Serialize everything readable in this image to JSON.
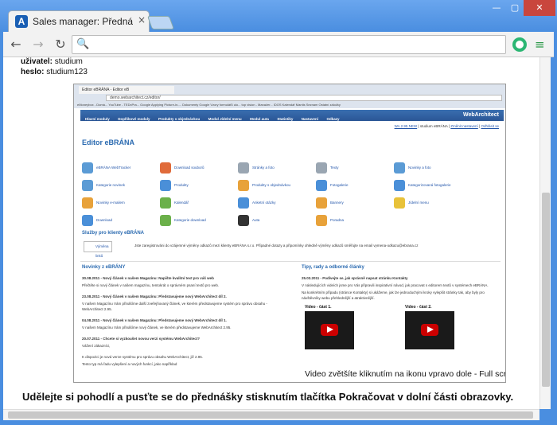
{
  "browser": {
    "tab_title": "Sales manager: Přednáška",
    "tab_close": "×",
    "min_glyph": "—",
    "max_glyph": "▢",
    "close_glyph": "✕",
    "back_glyph": "←",
    "forward_glyph": "→",
    "reload_glyph": "↻",
    "search_glyph": "🔍",
    "menu_glyph": "≡",
    "address_value": ""
  },
  "page": {
    "user_label": "uživatel:",
    "user_value": " studium",
    "pass_label": "heslo:",
    "pass_value": " studium123",
    "bottom_message": "Udělejte si pohodlí a pusťte se do přednášky stisknutím tlačítka Pokračovat v dolní části obrazovky.",
    "video_caption": "Video zvětšíte kliknutím na ikonu vpravo dole - Full screen"
  },
  "screenshot": {
    "tab": "Editor eBRÁNA - Editor eB",
    "url": "demo.webarchitect.cz/editor/",
    "bookmarks": "eMoneybox - Domá...  YouTube - TEDxPra...  Google  Applying Picture-in-...  Dokumenty Google  Vzory formulářů ulo...  top vision - Manažer...  IDOS  Kalendář  Mantis  Seznam  Ostatní záložky",
    "nav": [
      "Hlavní moduly",
      "Doplňkové moduly",
      "Produkty s objednávkou",
      "Modul Jídelní menu",
      "Modul auta",
      "Statistiky",
      "Nastavení",
      "Odkazy"
    ],
    "logo": "WebArchitect",
    "topbar_version": "WA 2.95 NEW",
    "topbar_user": " | studium eBRÁNA | ",
    "topbar_settings": "Změnit nastavení",
    "topbar_sep": " | ",
    "topbar_logout": "Odhlásit se",
    "editor_title": "Editor eBRÁNA",
    "modules": [
      {
        "label": "eBRÁNA WebTracker",
        "color": "#5b9bd5"
      },
      {
        "label": "Download souborů",
        "color": "#e06b3a"
      },
      {
        "label": "Stránky a foto",
        "color": "#9aa6b2"
      },
      {
        "label": "Texty",
        "color": "#9aa6b2"
      },
      {
        "label": "Novinky a foto",
        "color": "#5b9bd5"
      },
      {
        "label": "Kategorie novinek",
        "color": "#5b9bd5"
      },
      {
        "label": "Produkty",
        "color": "#4a8fd8"
      },
      {
        "label": "Produkty s objednávkou",
        "color": "#e8a23a"
      },
      {
        "label": "Fotogalerie",
        "color": "#4a8fd8"
      },
      {
        "label": "Kategorizovaná fotogalerie",
        "color": "#4a8fd8"
      },
      {
        "label": "Novinky e-mailem",
        "color": "#e8a23a"
      },
      {
        "label": "Kalendář",
        "color": "#6bb04a"
      },
      {
        "label": "Anketní otázky",
        "color": "#4a8fd8"
      },
      {
        "label": "Bannery",
        "color": "#e8a23a"
      },
      {
        "label": "Jídelní menu",
        "color": "#e8c23a"
      },
      {
        "label": "Download",
        "color": "#4a8fd8"
      },
      {
        "label": "Kategorie download",
        "color": "#6bb04a"
      },
      {
        "label": "Auta",
        "color": "#333333"
      },
      {
        "label": "Poradna",
        "color": "#e8a23a"
      }
    ],
    "services_title": "Služby pro klienty eBRÁNA",
    "services_btn": "Výměna linků",
    "services_text": "Jste zaregistrováni do vzájemné výměny odkazů mezi klienty eBRÁNA s.r.o. Případné dotazy a připomínky ohledně výměny odkazů směřujte na email vymena-odkazu@ebrana.cz",
    "news_title": "Novinky z eBRÁNY",
    "news": [
      "30.08.2011 - Nový článek v našem Magazínu: Napište kvalitní text pro váš web",
      "Přečtěte si nový článek v našem magazínu, tentokrát o správném psaní textů pro web.",
      "23.08.2011 - Nový článek v našem Magazínu: Představujeme nový WebArchitect díl 2.",
      "V našem Magazínu Vám přinášíme další zveřejňovaný článek, ve kterém představujeme systém pro správu obsahu - WebArchitect 2.95.",
      "04.08.2011 - Nový článek v našem Magazínu: Představujeme nový WebArchitect díl 1.",
      "V našem Magazínu Vám přinášíme nový článek, ve kterém představujeme WebArchitect 2.95.",
      "20.07.2011 - Chcete si vyzkoušet novou verzi systému WebArchitect?",
      "Vážení zákazníci,",
      "K dispozici je nová verze systému pro správu obsahu WebArchitect, již 2.95.",
      "Tento typ má řadu vylepšení a nových funkcí, jako například"
    ],
    "tips_title": "Tipy, rady a odborné články",
    "tips": [
      "25.03.2011 - Podívejte se, jak správně napsat stránku Kontakty",
      "V následujících videích jsme pro Vás připravili inspirativní návod, jak pracovat s editorem textů v systémech eBRÁNA.",
      "Na konkrétním případu (stránce Kontakty) si ukážeme, jak lze jednoduchými kroky vylepšit stránky tak, aby byly pro návštěvníky webu přehlednější a atraktivnější."
    ],
    "video1": "Video - část 1.",
    "video2": "Video - část 2."
  }
}
